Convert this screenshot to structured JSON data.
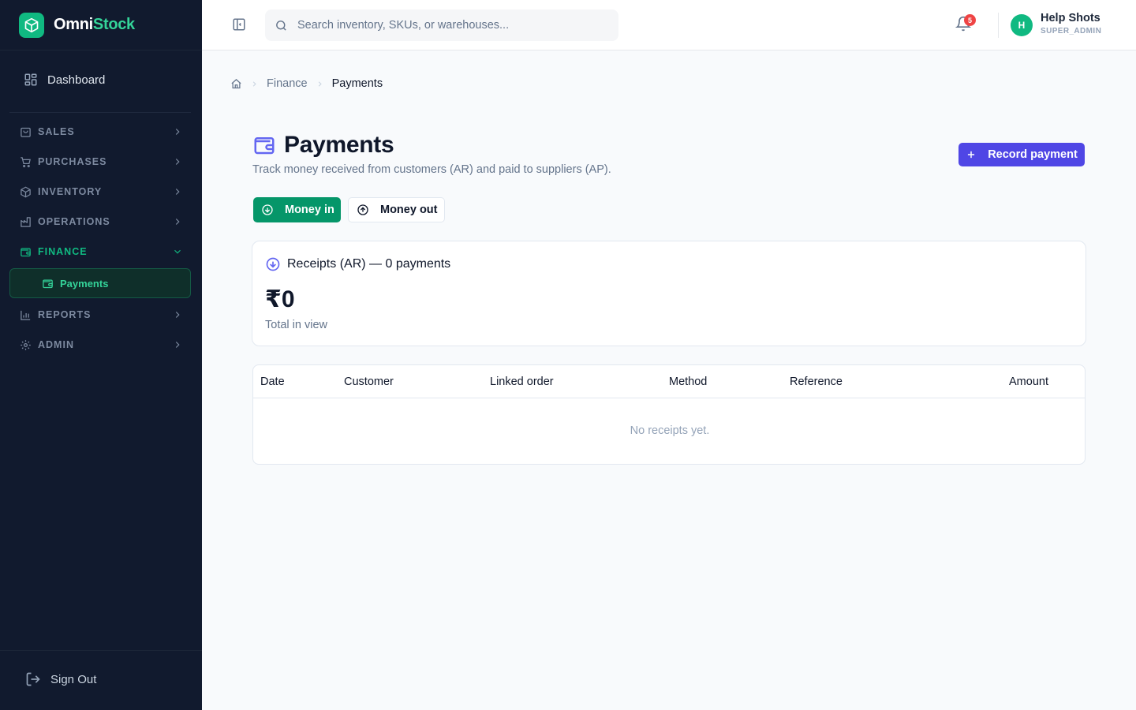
{
  "brand": {
    "name_part1": "Omni",
    "name_part2": "Stock",
    "accent": "#10b981"
  },
  "sidebar": {
    "dashboard": "Dashboard",
    "items": [
      {
        "label": "SALES",
        "icon": "bag-icon"
      },
      {
        "label": "PURCHASES",
        "icon": "cart-icon"
      },
      {
        "label": "INVENTORY",
        "icon": "box-icon"
      },
      {
        "label": "OPERATIONS",
        "icon": "factory-icon"
      },
      {
        "label": "FINANCE",
        "icon": "wallet-icon",
        "expanded": true
      },
      {
        "label": "REPORTS",
        "icon": "bar-chart-icon"
      },
      {
        "label": "ADMIN",
        "icon": "gear-icon"
      }
    ],
    "finance_sub": [
      {
        "label": "Payments",
        "active": true
      }
    ],
    "sign_out": "Sign Out"
  },
  "header": {
    "search_placeholder": "Search inventory, SKUs, or warehouses...",
    "notifications_count": "5",
    "user": {
      "initial": "H",
      "name": "Help Shots",
      "role": "SUPER_ADMIN"
    }
  },
  "breadcrumb": [
    "Finance",
    "Payments"
  ],
  "page": {
    "title": "Payments",
    "subtitle": "Track money received from customers (AR) and paid to suppliers (AP).",
    "record_button": "Record payment",
    "tabs": [
      {
        "label": "Money in",
        "active": true
      },
      {
        "label": "Money out",
        "active": false
      }
    ]
  },
  "summary": {
    "heading": "Receipts (AR) — 0 payments",
    "amount": "₹0",
    "note": "Total in view"
  },
  "table": {
    "columns": [
      "Date",
      "Customer",
      "Linked order",
      "Method",
      "Reference",
      "Amount"
    ],
    "rows": [],
    "empty_text": "No receipts yet."
  },
  "colors": {
    "primary": "#4f46e5",
    "success": "#059669",
    "sidebar_bg": "#111a2e",
    "danger": "#ef4444"
  }
}
